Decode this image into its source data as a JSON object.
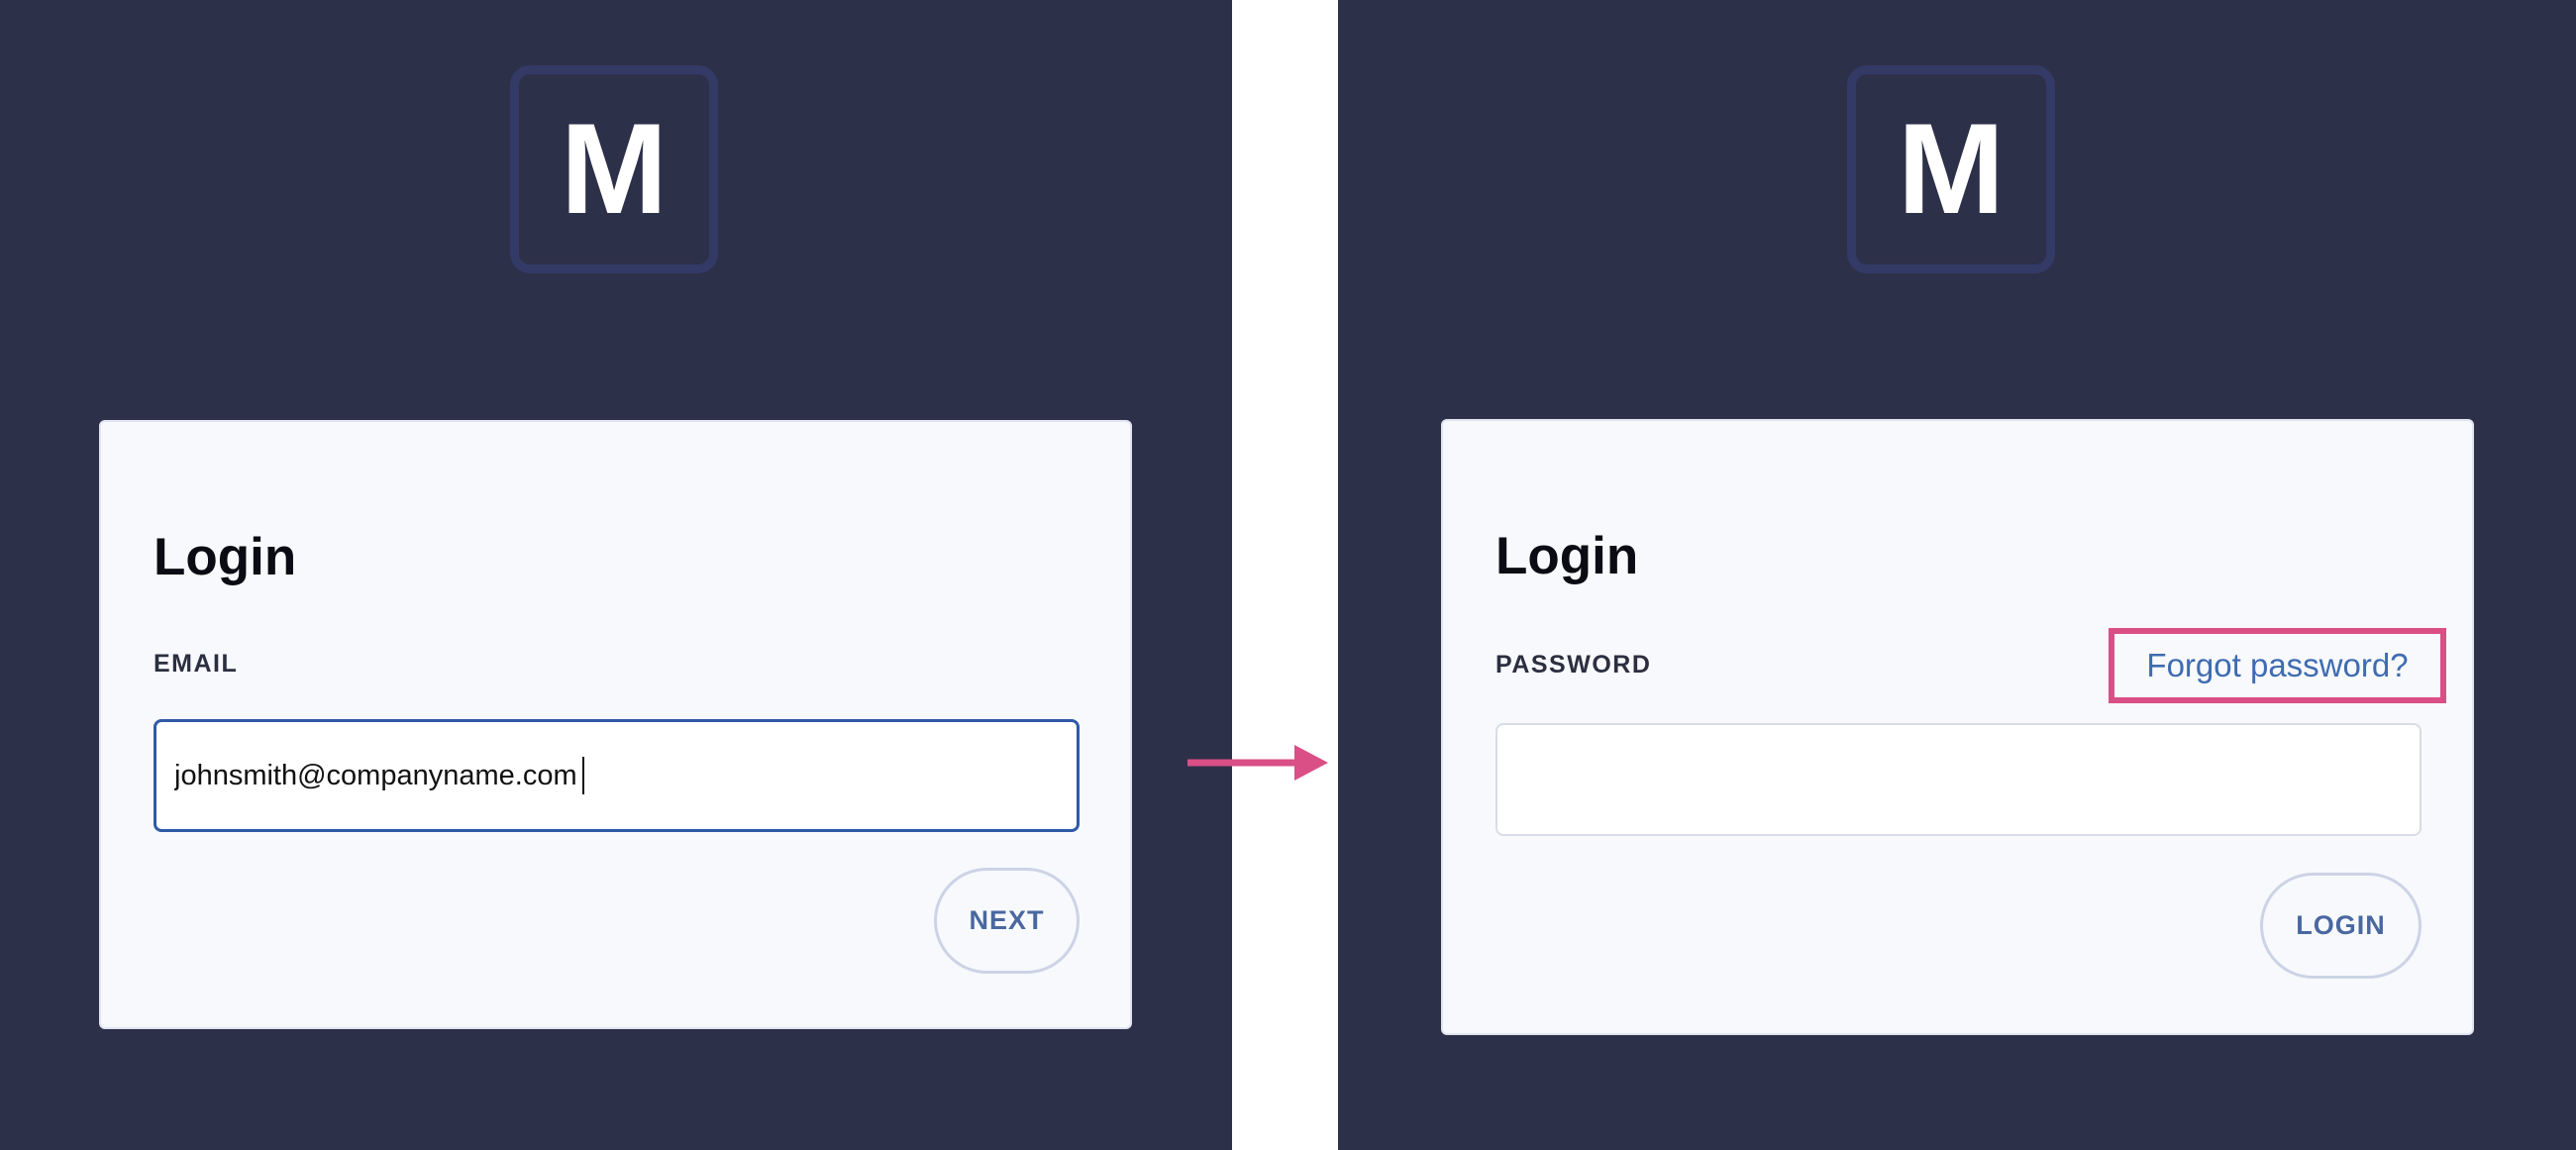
{
  "left_screen": {
    "logo": {
      "letter": "M",
      "icon": "m-logo-icon"
    },
    "login_card": {
      "title": "Login",
      "field_label": "EMAIL",
      "input_value": "johnsmith@companyname.com",
      "button_label": "NEXT"
    }
  },
  "right_screen": {
    "logo": {
      "letter": "M",
      "icon": "m-logo-icon"
    },
    "login_card": {
      "title": "Login",
      "field_label": "PASSWORD",
      "forgot_link": "Forgot password?",
      "input_value": "",
      "button_label": "LOGIN"
    }
  },
  "transition": {
    "icon": "arrow-right-icon",
    "color": "#d94f86"
  },
  "colors": {
    "panel_background": "#2d3049",
    "logo_border": "#343a66",
    "card_background": "#f7f9fc",
    "input_focus_border": "#2f5aa6",
    "link_text": "#3f6bb0",
    "highlight_border": "#d94f86",
    "button_text": "#4a67a0"
  }
}
